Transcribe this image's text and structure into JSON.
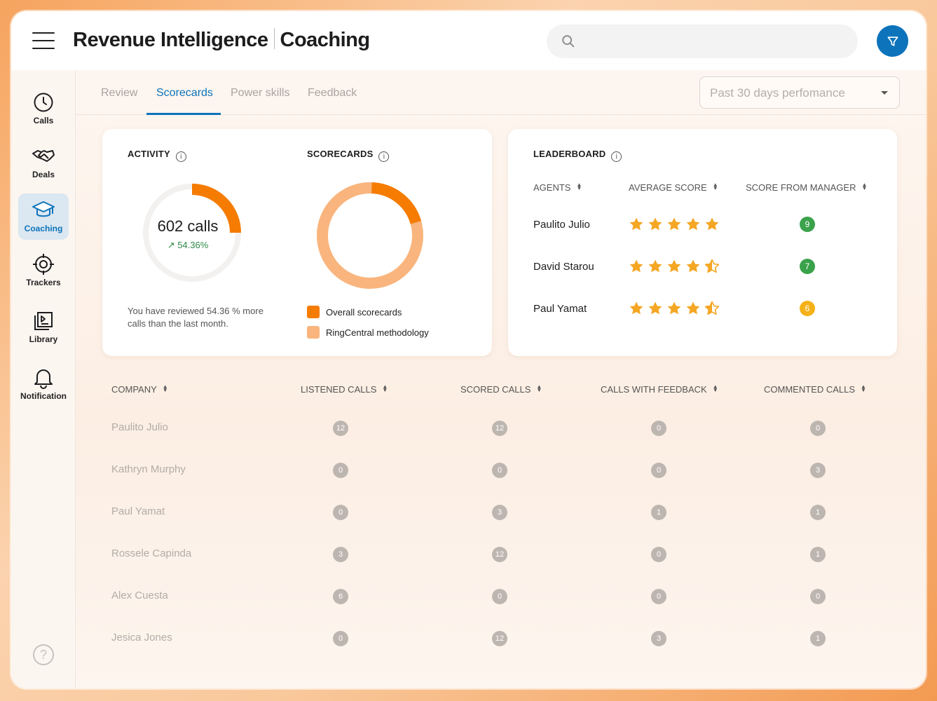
{
  "header": {
    "title_primary": "Revenue Intelligence",
    "title_secondary": "Coaching",
    "search_placeholder": ""
  },
  "sidebar": {
    "items": [
      {
        "label": "Calls",
        "icon": "clock-icon"
      },
      {
        "label": "Deals",
        "icon": "handshake-icon"
      },
      {
        "label": "Coaching",
        "icon": "graduation-cap-icon",
        "active": true
      },
      {
        "label": "Trackers",
        "icon": "crosshair-icon"
      },
      {
        "label": "Library",
        "icon": "library-icon"
      },
      {
        "label": "Notification",
        "icon": "bell-icon"
      }
    ],
    "help_label": "?"
  },
  "tabs": [
    {
      "label": "Review"
    },
    {
      "label": "Scorecards",
      "active": true
    },
    {
      "label": "Power skills"
    },
    {
      "label": "Feedback"
    }
  ],
  "period_select": {
    "value": "Past 30 days perfomance"
  },
  "activity": {
    "title": "ACTIVITY",
    "calls": "602 calls",
    "trend": "54.36%",
    "trend_fraction": 0.25,
    "note": "You have reviewed 54.36 % more calls than the last month."
  },
  "scorecards": {
    "title": "SCORECARDS",
    "overall_fraction": 0.2,
    "legend": [
      {
        "label": "Overall scorecards",
        "color": "#f57c00"
      },
      {
        "label": "RingCentral methodology",
        "color": "#f9b57d"
      }
    ]
  },
  "leaderboard": {
    "title": "LEADERBOARD",
    "columns": [
      "AGENTS",
      "AVERAGE SCORE",
      "SCORE FROM MANAGER"
    ],
    "rows": [
      {
        "agent": "Paulito Julio",
        "stars": 5,
        "manager_score": "9",
        "badge_color": "#3aa24a"
      },
      {
        "agent": "David Starou",
        "stars": 4.5,
        "manager_score": "7",
        "badge_color": "#3aa24a"
      },
      {
        "agent": "Paul Yamat",
        "stars": 4.5,
        "manager_score": "6",
        "badge_color": "#f5b118"
      }
    ]
  },
  "table": {
    "columns": [
      "COMPANY",
      "LISTENED CALLS",
      "SCORED CALLS",
      "CALLS WITH FEEDBACK",
      "COMMENTED CALLS"
    ],
    "rows": [
      {
        "name": "Paulito Julio",
        "values": [
          "12",
          "12",
          "0",
          "0"
        ]
      },
      {
        "name": "Kathryn Murphy",
        "values": [
          "0",
          "0",
          "0",
          "3"
        ]
      },
      {
        "name": "Paul Yamat",
        "values": [
          "0",
          "3",
          "1",
          "1"
        ]
      },
      {
        "name": "Rossele Capinda",
        "values": [
          "3",
          "12",
          "0",
          "1"
        ]
      },
      {
        "name": "Alex Cuesta",
        "values": [
          "6",
          "0",
          "0",
          "0"
        ]
      },
      {
        "name": "Jesica Jones",
        "values": [
          "0",
          "12",
          "3",
          "1"
        ]
      }
    ]
  },
  "colors": {
    "accent": "#0d73bb",
    "orange": "#f57c00",
    "light_orange": "#f9b57d",
    "star": "#f5a623"
  }
}
